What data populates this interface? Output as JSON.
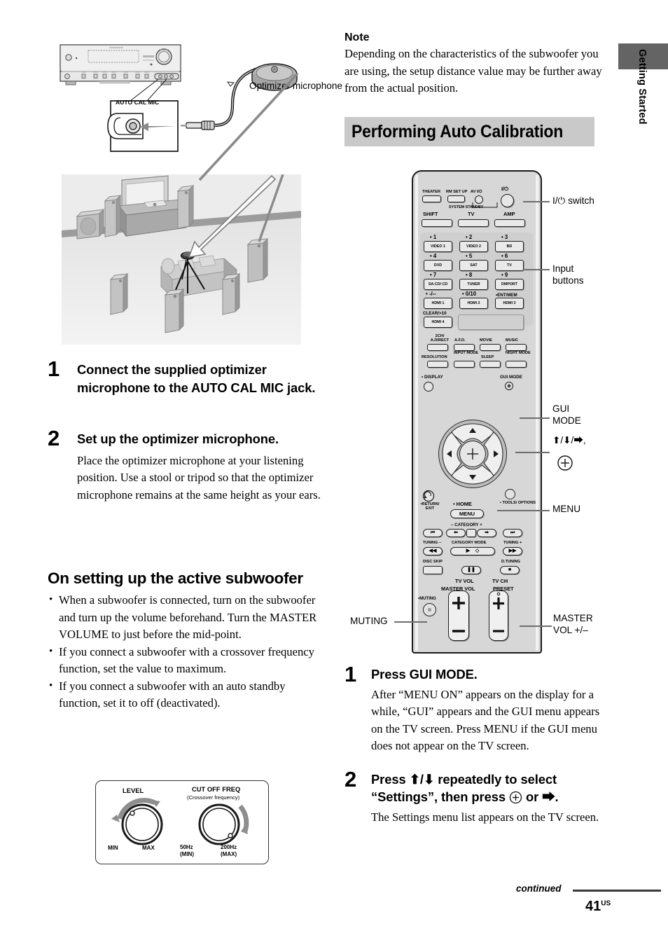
{
  "side_tab": {
    "label": "Getting Started"
  },
  "left_column": {
    "mic_caption": "Optimizer microphone",
    "jack_label": "AUTO CAL MIC",
    "steps": [
      {
        "num": "1",
        "heading": "Connect the supplied optimizer microphone to the AUTO CAL MIC jack.",
        "body": ""
      },
      {
        "num": "2",
        "heading": "Set up the optimizer microphone.",
        "body": "Place the optimizer microphone at your listening position. Use a stool or tripod so that the optimizer microphone remains at the same height as your ears."
      }
    ],
    "subwoofer_section": {
      "heading": "On setting up the active subwoofer",
      "bullets": [
        "When a subwoofer is connected, turn on the subwoofer and turn up the volume beforehand. Turn the MASTER VOLUME to just before the mid-point.",
        "If you connect a subwoofer with a crossover frequency function, set the value to maximum.",
        "If you connect a subwoofer with an auto standby function, set it to off (deactivated)."
      ]
    },
    "knob_panel": {
      "level_title": "LEVEL",
      "level_min": "MIN",
      "level_max": "MAX",
      "cutoff_title": "CUT OFF FREQ",
      "cutoff_sub": "(Crossover frequency)",
      "cutoff_min": "50Hz\n(MIN)",
      "cutoff_max": "200Hz\n(MAX)"
    }
  },
  "right_column": {
    "note": {
      "heading": "Note",
      "text": "Depending on the characteristics of the subwoofer you are using, the setup distance value may be further away from the actual position."
    },
    "section_title": "Performing Auto Calibration",
    "steps": [
      {
        "num": "1",
        "heading": "Press GUI MODE.",
        "body": "After “MENU ON” appears on the display for a while, “GUI” appears and the GUI menu appears on the TV screen. Press MENU if the GUI menu does not appear on the TV screen."
      },
      {
        "num": "2",
        "heading_pre": "Press ",
        "heading_arrows": "⬆/⬇",
        "heading_mid": " repeatedly to select “Settings”, then press ",
        "heading_post": " or ⮕.",
        "body": "The Settings menu list appears on the TV screen."
      }
    ]
  },
  "remote": {
    "top_row": [
      {
        "label": "THEATER"
      },
      {
        "label": "RM SET UP"
      },
      {
        "label": "AV I/⏻"
      }
    ],
    "power_label": "I/⏻",
    "system_standby": "SYSTEM STANDBY",
    "mode_row": [
      {
        "label": "SHIFT"
      },
      {
        "label": "TV"
      },
      {
        "label": "AMP"
      }
    ],
    "input_buttons": [
      {
        "num": "• 1",
        "label": "VIDEO 1"
      },
      {
        "num": "• 2",
        "label": "VIDEO 2"
      },
      {
        "num": "• 3",
        "label": "BD"
      },
      {
        "num": "• 4",
        "label": "DVD"
      },
      {
        "num": "• 5",
        "label": "SAT"
      },
      {
        "num": "• 6",
        "label": "TV"
      },
      {
        "num": "• 7",
        "label": "SA-CD/ CD"
      },
      {
        "num": "• 8",
        "label": "TUNER"
      },
      {
        "num": "• 9",
        "label": "DMPORT"
      },
      {
        "num": "• -/--",
        "label": "HDMI 1"
      },
      {
        "num": "• 0/10",
        "label": "HDMI 2"
      },
      {
        "num": "•ENT/MEM",
        "label": "HDMI 3"
      },
      {
        "num": "CLEAR/>10",
        "label": "HDMI 4"
      }
    ],
    "sound_field_row1": [
      {
        "label": "2CH/ A.DIRECT"
      },
      {
        "label": "A.F.D."
      },
      {
        "label": "MOVIE"
      },
      {
        "label": "MUSIC"
      }
    ],
    "sound_field_row2": [
      {
        "label": "RESOLUTION"
      },
      {
        "label": "INPUT MODE"
      },
      {
        "label": "SLEEP"
      },
      {
        "label": "NIGHT MODE"
      }
    ],
    "display_label": "• DISPLAY",
    "gui_mode_label": "GUI MODE",
    "return_label": "•RETURN/ EXIT",
    "home_label": "• HOME",
    "menu_label": "MENU",
    "tools_label": "• TOOLS/ OPTIONS",
    "category_label": "– CATEGORY +",
    "tuning_minus": "TUNING –",
    "category_mode": "CATEGORY MODE",
    "tuning_plus": "TUNING +",
    "disc_skip": "DISC SKIP",
    "d_tuning": "D.TUNING",
    "tv_vol": "TV VOL",
    "master_vol": "MASTER VOL",
    "tv_ch": "TV CH",
    "preset": "PRESET",
    "muting_btn_label": "•MUTING",
    "plus": "+",
    "minus": "–"
  },
  "callouts": {
    "power_switch": "I/⏻ switch",
    "input_buttons": "Input\nbuttons",
    "gui_mode": "GUI\nMODE",
    "dpad": "⬆/⬇/⮕,",
    "menu": "MENU",
    "muting": "MUTING",
    "master_vol": "MASTER\nVOL +/–"
  },
  "footer": {
    "continued": "continued",
    "page": "41",
    "region": "US"
  },
  "colors": {
    "band_gray": "#c9c9c9",
    "tab_gray": "#646464",
    "remote_body": "#d7d7d7",
    "callout_line": "#6d6d6d"
  }
}
